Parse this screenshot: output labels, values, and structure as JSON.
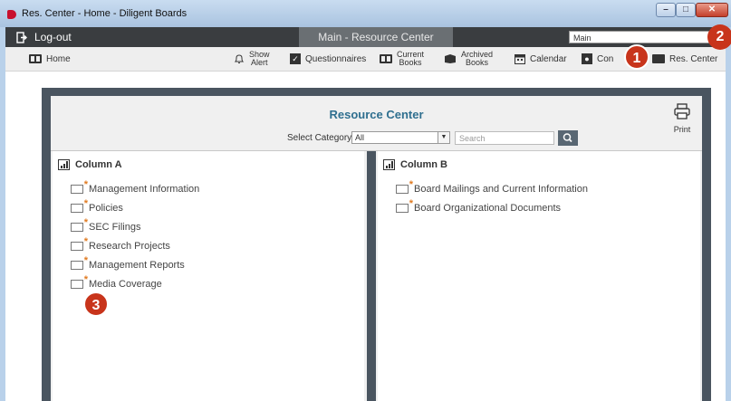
{
  "window": {
    "title": "Res. Center - Home - Diligent Boards"
  },
  "topbar": {
    "logout_label": "Log-out",
    "active_tab": "Main - Resource Center",
    "module_select_value": "Main"
  },
  "toolbar": {
    "home": "Home",
    "show_alert_1": "Show",
    "show_alert_2": "Alert",
    "questionnaires": "Questionnaires",
    "current_books_1": "Current",
    "current_books_2": "Books",
    "archived_books_1": "Archived",
    "archived_books_2": "Books",
    "calendar": "Calendar",
    "contacts_partial": "Con",
    "res_center": "Res. Center"
  },
  "resource_center": {
    "title": "Resource Center",
    "category_label": "Select Category",
    "category_value": "All",
    "search_placeholder": "Search",
    "print_label": "Print"
  },
  "column_a": {
    "title": "Column A",
    "items": [
      "Management Information",
      "Policies",
      "SEC Filings",
      "Research Projects",
      "Management Reports",
      "Media Coverage"
    ]
  },
  "column_b": {
    "title": "Column B",
    "items": [
      "Board Mailings and Current Information",
      "Board Organizational Documents"
    ]
  },
  "callouts": [
    "1",
    "2",
    "3"
  ],
  "colors": {
    "accent_title": "#2f6f8f",
    "callout": "#c8341b",
    "frame": "#4a5560",
    "dark_bar": "#3a3d40"
  }
}
